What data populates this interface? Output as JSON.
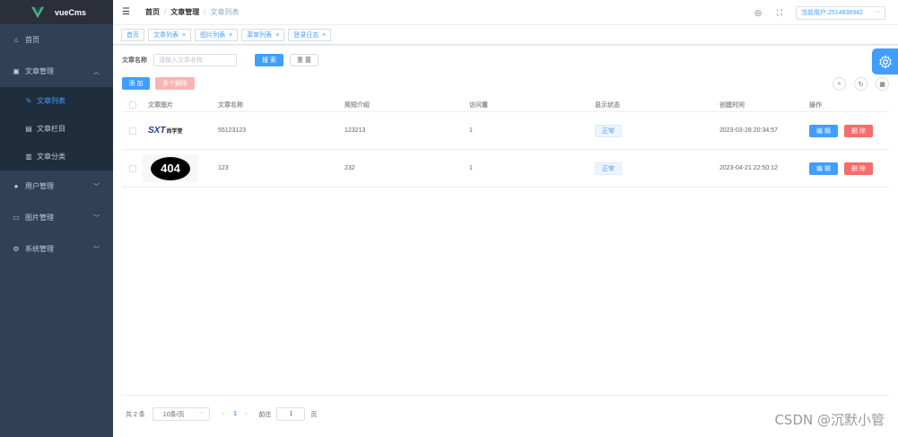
{
  "app": {
    "name": "vueCms",
    "brand_color": "#41b883"
  },
  "sidebar": {
    "items": [
      {
        "label": "首页",
        "icon": "home-icon"
      },
      {
        "label": "文章管理",
        "icon": "document-icon",
        "expanded": true,
        "children": [
          {
            "label": "文章列表",
            "icon": "edit-icon",
            "active": true
          },
          {
            "label": "文章栏目",
            "icon": "column-icon"
          },
          {
            "label": "文章分类",
            "icon": "category-icon"
          }
        ]
      },
      {
        "label": "用户管理",
        "icon": "user-icon"
      },
      {
        "label": "图片管理",
        "icon": "picture-icon"
      },
      {
        "label": "系统管理",
        "icon": "settings-icon"
      }
    ]
  },
  "navbar": {
    "breadcrumb": [
      "首页",
      "文章管理",
      "文章列表"
    ],
    "user_label": "当前用户:2514838942"
  },
  "tags": [
    "首页",
    "文章列表",
    "图片列表",
    "菜单列表",
    "登录日志"
  ],
  "search": {
    "label": "文章名称",
    "placeholder": "请输入文章名称",
    "search_button": "搜 索",
    "reset_button": "重 置"
  },
  "actions": {
    "add": "添 加",
    "multi_delete": "多个删除"
  },
  "table": {
    "columns": [
      "文章图片",
      "文章名称",
      "简短介绍",
      "访问量",
      "显示状态",
      "创建时间",
      "操作"
    ],
    "rows": [
      {
        "image": "SXT 尚学堂",
        "name": "55123123",
        "intro": "123213",
        "visits": "1",
        "status": "正常",
        "created": "2023-03-28 20:34:57"
      },
      {
        "image": "404",
        "name": "123",
        "intro": "232",
        "visits": "1",
        "status": "正常",
        "created": "2023-04-21 22:50:12"
      }
    ],
    "edit_label": "编 辑",
    "delete_label": "删 除"
  },
  "pagination": {
    "total": "共 2 条",
    "page_size": "10条/页",
    "current": "1",
    "goto_label": "前往",
    "goto_value": "1",
    "goto_unit": "页"
  },
  "watermark": "CSDN @沉默小管",
  "colors": {
    "primary": "#409eff",
    "danger": "#f56c6c",
    "sidebar_bg": "#304156"
  }
}
